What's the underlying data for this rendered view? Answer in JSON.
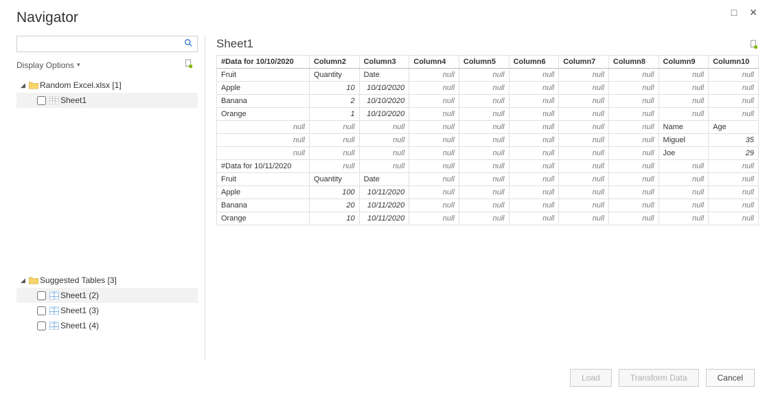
{
  "window": {
    "title": "Navigator",
    "maximize_glyph": "□",
    "close_glyph": "✕"
  },
  "sidebar": {
    "search_placeholder": "",
    "display_options_label": "Display Options",
    "file": {
      "name": "Random Excel.xlsx [1]",
      "sheets": [
        {
          "label": "Sheet1",
          "selected": true
        }
      ]
    },
    "suggested": {
      "header": "Suggested Tables [3]",
      "items": [
        {
          "label": "Sheet1 (2)"
        },
        {
          "label": "Sheet1 (3)"
        },
        {
          "label": "Sheet1 (4)"
        }
      ]
    }
  },
  "preview": {
    "title": "Sheet1",
    "columns": [
      "#Data for 10/10/2020",
      "Column2",
      "Column3",
      "Column4",
      "Column5",
      "Column6",
      "Column7",
      "Column8",
      "Column9",
      "Column10"
    ],
    "rows": [
      [
        {
          "v": "Fruit"
        },
        {
          "v": "Quantity"
        },
        {
          "v": "Date"
        },
        {
          "n": true
        },
        {
          "n": true
        },
        {
          "n": true
        },
        {
          "n": true
        },
        {
          "n": true
        },
        {
          "n": true
        },
        {
          "n": true
        }
      ],
      [
        {
          "v": "Apple"
        },
        {
          "v": "10",
          "r": true,
          "i": true
        },
        {
          "v": "10/10/2020",
          "r": true,
          "i": true
        },
        {
          "n": true
        },
        {
          "n": true
        },
        {
          "n": true
        },
        {
          "n": true
        },
        {
          "n": true
        },
        {
          "n": true
        },
        {
          "n": true
        }
      ],
      [
        {
          "v": "Banana"
        },
        {
          "v": "2",
          "r": true,
          "i": true
        },
        {
          "v": "10/10/2020",
          "r": true,
          "i": true
        },
        {
          "n": true
        },
        {
          "n": true
        },
        {
          "n": true
        },
        {
          "n": true
        },
        {
          "n": true
        },
        {
          "n": true
        },
        {
          "n": true
        }
      ],
      [
        {
          "v": "Orange"
        },
        {
          "v": "1",
          "r": true,
          "i": true
        },
        {
          "v": "10/10/2020",
          "r": true,
          "i": true
        },
        {
          "n": true
        },
        {
          "n": true
        },
        {
          "n": true
        },
        {
          "n": true
        },
        {
          "n": true
        },
        {
          "n": true
        },
        {
          "n": true
        }
      ],
      [
        {
          "n": true
        },
        {
          "n": true
        },
        {
          "n": true
        },
        {
          "n": true
        },
        {
          "n": true
        },
        {
          "n": true
        },
        {
          "n": true
        },
        {
          "n": true
        },
        {
          "v": "Name"
        },
        {
          "v": "Age"
        }
      ],
      [
        {
          "n": true
        },
        {
          "n": true
        },
        {
          "n": true
        },
        {
          "n": true
        },
        {
          "n": true
        },
        {
          "n": true
        },
        {
          "n": true
        },
        {
          "n": true
        },
        {
          "v": "Miguel"
        },
        {
          "v": "35",
          "r": true,
          "i": true
        }
      ],
      [
        {
          "n": true
        },
        {
          "n": true
        },
        {
          "n": true
        },
        {
          "n": true
        },
        {
          "n": true
        },
        {
          "n": true
        },
        {
          "n": true
        },
        {
          "n": true
        },
        {
          "v": "Joe"
        },
        {
          "v": "29",
          "r": true,
          "i": true
        }
      ],
      [
        {
          "v": "#Data for 10/11/2020"
        },
        {
          "n": true
        },
        {
          "n": true
        },
        {
          "n": true
        },
        {
          "n": true
        },
        {
          "n": true
        },
        {
          "n": true
        },
        {
          "n": true
        },
        {
          "n": true
        },
        {
          "n": true
        }
      ],
      [
        {
          "v": "Fruit"
        },
        {
          "v": "Quantity"
        },
        {
          "v": "Date"
        },
        {
          "n": true
        },
        {
          "n": true
        },
        {
          "n": true
        },
        {
          "n": true
        },
        {
          "n": true
        },
        {
          "n": true
        },
        {
          "n": true
        }
      ],
      [
        {
          "v": "Apple"
        },
        {
          "v": "100",
          "r": true,
          "i": true
        },
        {
          "v": "10/11/2020",
          "r": true,
          "i": true
        },
        {
          "n": true
        },
        {
          "n": true
        },
        {
          "n": true
        },
        {
          "n": true
        },
        {
          "n": true
        },
        {
          "n": true
        },
        {
          "n": true
        }
      ],
      [
        {
          "v": "Banana"
        },
        {
          "v": "20",
          "r": true,
          "i": true
        },
        {
          "v": "10/11/2020",
          "r": true,
          "i": true
        },
        {
          "n": true
        },
        {
          "n": true
        },
        {
          "n": true
        },
        {
          "n": true
        },
        {
          "n": true
        },
        {
          "n": true
        },
        {
          "n": true
        }
      ],
      [
        {
          "v": "Orange"
        },
        {
          "v": "10",
          "r": true,
          "i": true
        },
        {
          "v": "10/11/2020",
          "r": true,
          "i": true
        },
        {
          "n": true
        },
        {
          "n": true
        },
        {
          "n": true
        },
        {
          "n": true
        },
        {
          "n": true
        },
        {
          "n": true
        },
        {
          "n": true
        }
      ]
    ]
  },
  "footer": {
    "load": "Load",
    "transform": "Transform Data",
    "cancel": "Cancel"
  },
  "null_text": "null"
}
